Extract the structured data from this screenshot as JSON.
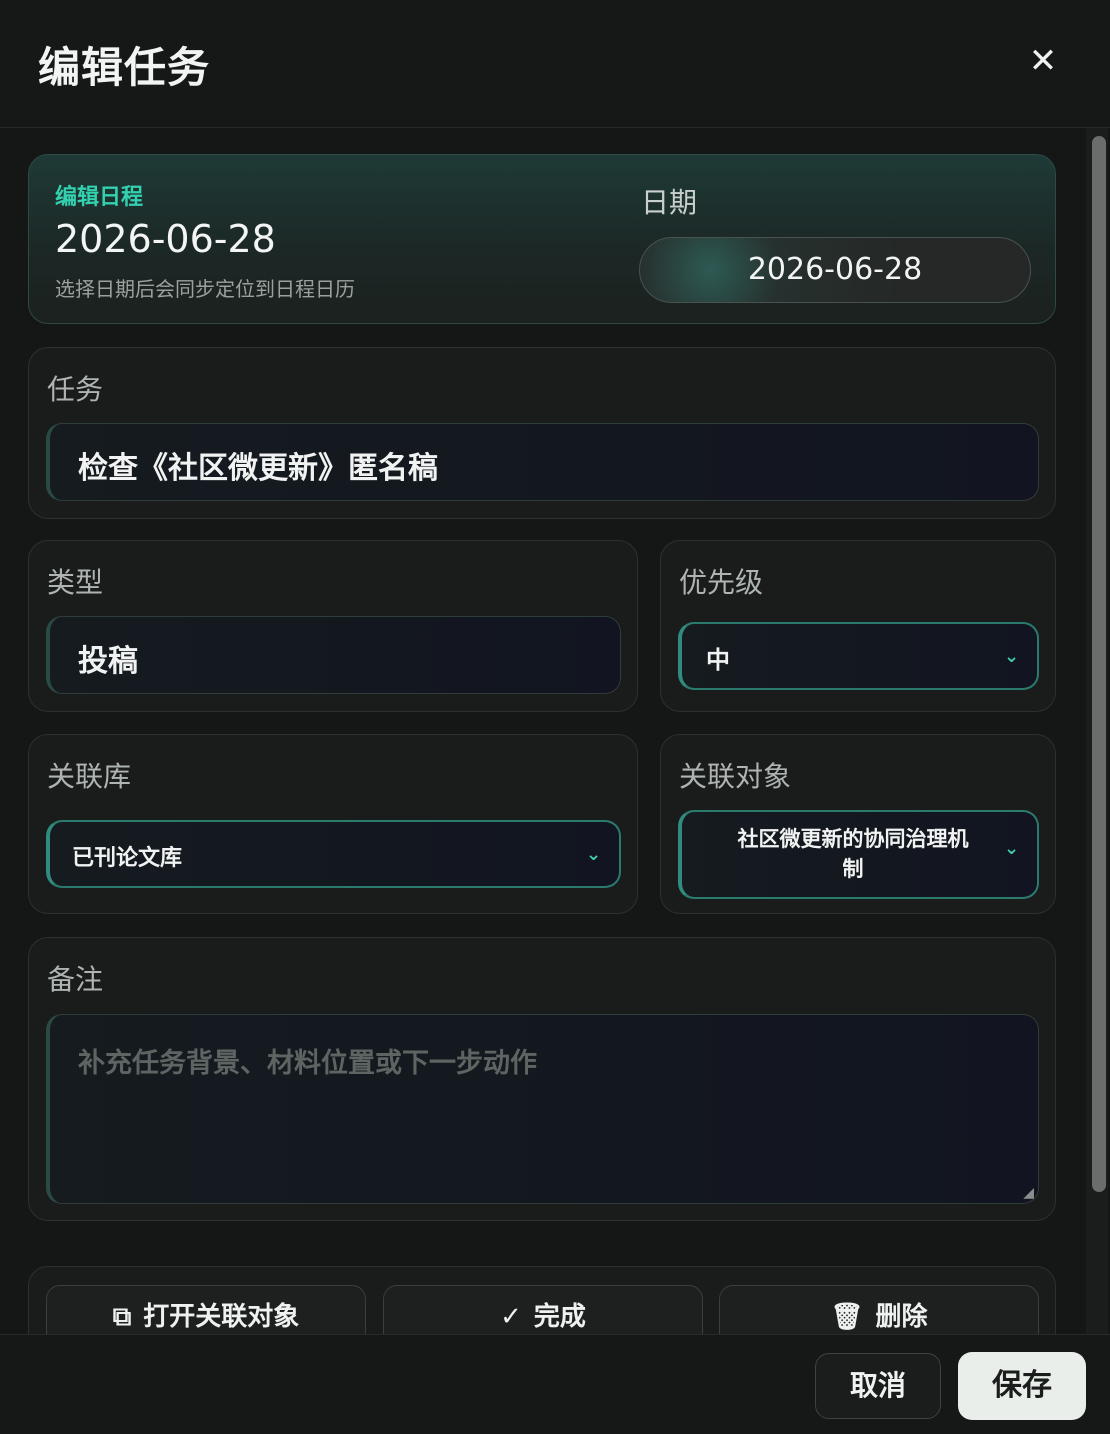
{
  "dialog": {
    "title": "编辑任务",
    "close_icon": "close-icon"
  },
  "schedule": {
    "kicker": "编辑日程",
    "current_date": "2026-06-28",
    "hint": "选择日期后会同步定位到日程日历",
    "date_label": "日期",
    "date_value": "2026-06-28"
  },
  "task": {
    "label": "任务",
    "value": "检查《社区微更新》匿名稿"
  },
  "type": {
    "label": "类型",
    "value": "投稿"
  },
  "priority": {
    "label": "优先级",
    "value": "中",
    "icon": "chevron-down-icon"
  },
  "library": {
    "label": "关联库",
    "value": "已刊论文库",
    "icon": "chevron-down-icon"
  },
  "target": {
    "label": "关联对象",
    "value_line1": "社区微更新的协同治理机",
    "value_line2": "制",
    "icon": "chevron-down-icon"
  },
  "notes": {
    "label": "备注",
    "placeholder": "补充任务背景、材料位置或下一步动作"
  },
  "actions": {
    "open": {
      "label": "打开关联对象",
      "icon": "external-link-icon"
    },
    "done": {
      "label": "完成",
      "icon": "check-icon"
    },
    "delete": {
      "label": "删除",
      "icon": "trash-icon"
    }
  },
  "footer": {
    "cancel_label": "取消",
    "save_label": "保存"
  },
  "colors": {
    "accent": "#34d1b0",
    "background": "#151716",
    "save_bg": "#e9eeea"
  }
}
